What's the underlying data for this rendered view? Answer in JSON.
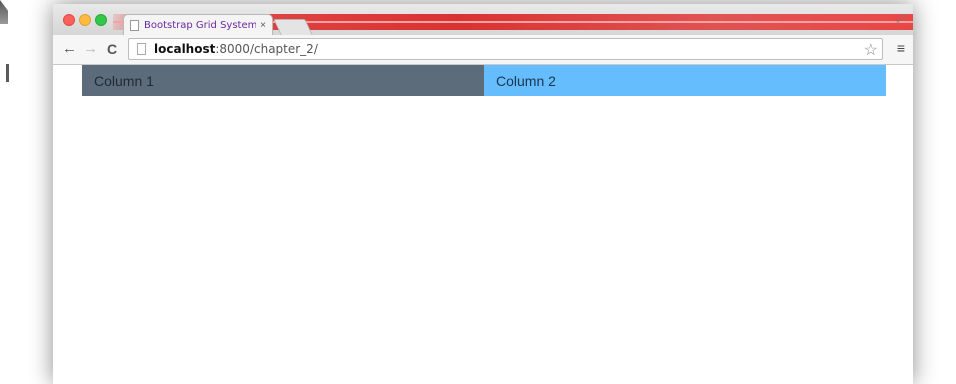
{
  "browser": {
    "tab": {
      "title": "Bootstrap Grid Systems",
      "close": "×"
    },
    "nav": {
      "back": "←",
      "forward": "→",
      "reload": "C"
    },
    "address": {
      "host": "localhost",
      "rest": ":8000/chapter_2/"
    },
    "star": "☆",
    "menu": "≡",
    "corner": "⤢"
  },
  "page": {
    "columns": [
      {
        "label": "Column 1",
        "color": "#5c6c7a"
      },
      {
        "label": "Column 2",
        "color": "#65bdfd"
      }
    ]
  }
}
